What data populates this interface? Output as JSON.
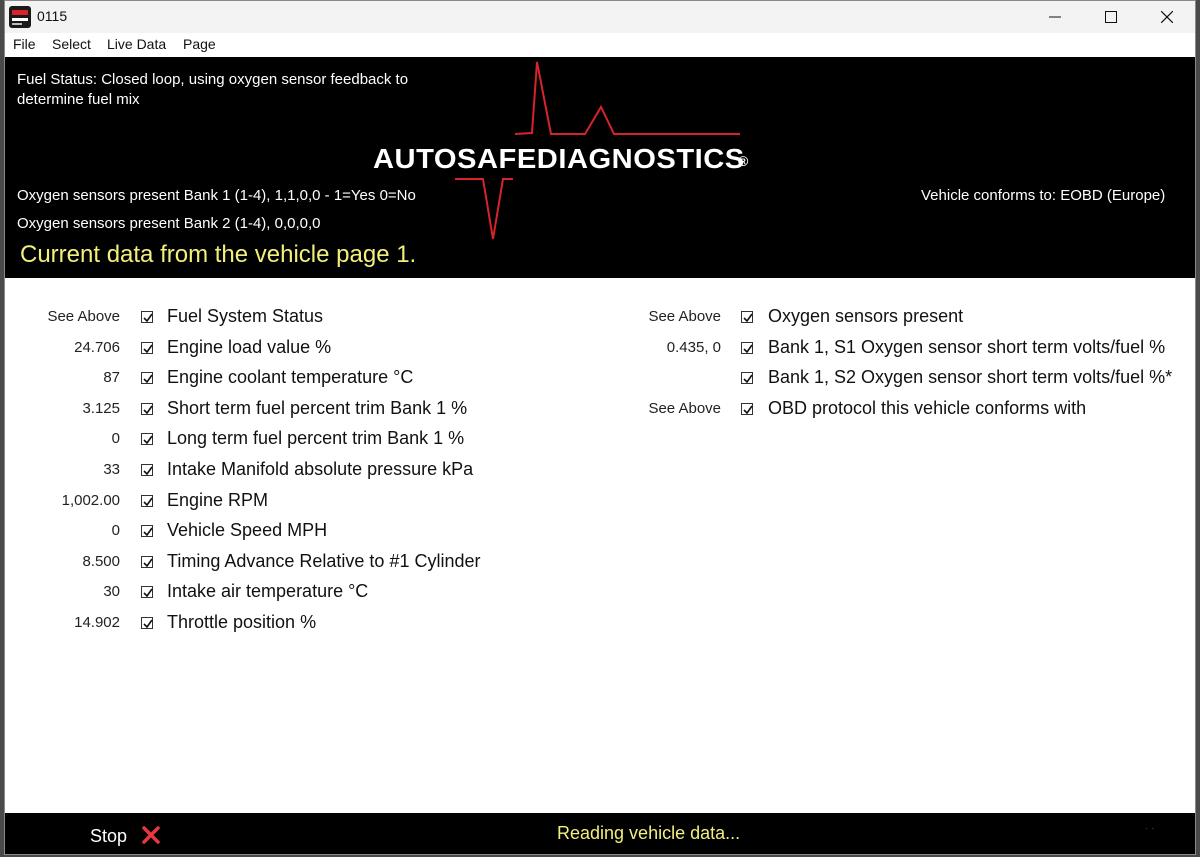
{
  "window": {
    "title": "0115",
    "icon": "autosafe-app-icon"
  },
  "menu": [
    "File",
    "Select",
    "Live Data",
    "Page"
  ],
  "header": {
    "fuel_status": "Fuel Status: Closed loop, using oxygen sensor feedback to determine fuel mix",
    "oxygen_bank1": "Oxygen sensors present Bank 1 (1-4), 1,1,0,0 - 1=Yes 0=No",
    "oxygen_bank2": "Oxygen sensors present Bank 2 (1-4), 0,0,0,0",
    "conforms": "Vehicle conforms to: EOBD (Europe)",
    "page_title": "Current data from the vehicle page 1.",
    "logo_text": "AUTOSAFEDIAGNOSTICS",
    "logo_reg": "®",
    "heading_color": "#f2ef7c",
    "logo_accent": "#d8232a"
  },
  "left_params": [
    {
      "value": "See Above",
      "label": "Fuel System Status",
      "checked": true
    },
    {
      "value": "24.706",
      "label": "Engine load value %",
      "checked": true
    },
    {
      "value": "87",
      "label": "Engine coolant temperature °C",
      "checked": true
    },
    {
      "value": "3.125",
      "label": "Short term fuel percent trim Bank 1 %",
      "checked": true
    },
    {
      "value": "0",
      "label": "Long term fuel percent trim Bank 1 %",
      "checked": true
    },
    {
      "value": "33",
      "label": "Intake Manifold absolute pressure kPa",
      "checked": true
    },
    {
      "value": "1,002.00",
      "label": "Engine RPM",
      "checked": true
    },
    {
      "value": "0",
      "label": "Vehicle Speed MPH",
      "checked": true
    },
    {
      "value": "8.500",
      "label": "Timing Advance Relative to #1 Cylinder",
      "checked": true
    },
    {
      "value": "30",
      "label": "Intake air temperature °C",
      "checked": true
    },
    {
      "value": "14.902",
      "label": "Throttle position %",
      "checked": true
    }
  ],
  "right_params": [
    {
      "value": "See Above",
      "label": "Oxygen sensors present",
      "checked": true
    },
    {
      "value": "0.435, 0",
      "label": "Bank 1, S1 Oxygen sensor short term volts/fuel %",
      "checked": true
    },
    {
      "value": "",
      "label": "Bank 1, S2 Oxygen sensor short term volts/fuel %*",
      "checked": true
    },
    {
      "value": "See Above",
      "label": "OBD protocol this vehicle conforms with",
      "checked": true
    }
  ],
  "status": {
    "stop_label": "Stop",
    "stop_icon": "close-x-icon",
    "message": "Reading vehicle data...",
    "indicator": "· ·"
  }
}
